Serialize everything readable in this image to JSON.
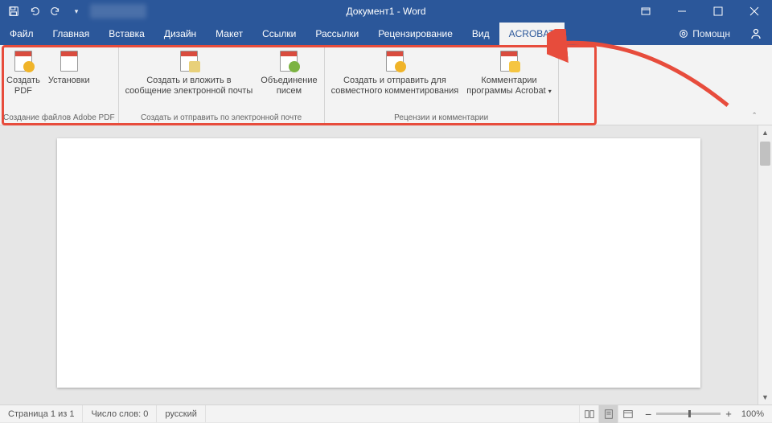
{
  "title": "Документ1 - Word",
  "tabs": [
    "Файл",
    "Главная",
    "Вставка",
    "Дизайн",
    "Макет",
    "Ссылки",
    "Рассылки",
    "Рецензирование",
    "Вид",
    "ACROBAT"
  ],
  "activeTab": "ACROBAT",
  "help": "Помощн",
  "ribbon": {
    "groups": [
      {
        "label": "Создание файлов Adobe PDF",
        "items": [
          {
            "label": "Создать\nPDF",
            "badge": "b-gear"
          },
          {
            "label": "Установки",
            "badge": ""
          }
        ]
      },
      {
        "label": "Создать и отправить по электронной почте",
        "items": [
          {
            "label": "Создать и вложить в\nсообщение электронной почты",
            "badge": "b-mail"
          },
          {
            "label": "Объединение\nписем",
            "badge": "b-down"
          }
        ]
      },
      {
        "label": "Рецензии и комментарии",
        "items": [
          {
            "label": "Создать и отправить для\nсовместного комментирования",
            "badge": "b-gear"
          },
          {
            "label": "Комментарии\nпрограммы Acrobat",
            "badge": "b-bubble",
            "dropdown": true
          }
        ]
      }
    ]
  },
  "status": {
    "page": "Страница 1 из 1",
    "words": "Число слов: 0",
    "lang": "русский",
    "zoom": "100%"
  },
  "zoomMinus": "−",
  "zoomPlus": "+"
}
